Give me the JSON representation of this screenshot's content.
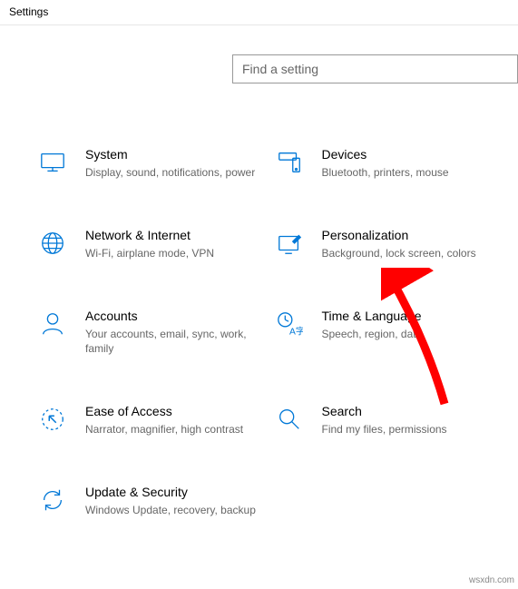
{
  "window": {
    "title": "Settings"
  },
  "search": {
    "placeholder": "Find a setting"
  },
  "tiles": {
    "system": {
      "title": "System",
      "desc": "Display, sound, notifications, power"
    },
    "devices": {
      "title": "Devices",
      "desc": "Bluetooth, printers, mouse"
    },
    "network": {
      "title": "Network & Internet",
      "desc": "Wi-Fi, airplane mode, VPN"
    },
    "personalization": {
      "title": "Personalization",
      "desc": "Background, lock screen, colors"
    },
    "accounts": {
      "title": "Accounts",
      "desc": "Your accounts, email, sync, work, family"
    },
    "timelang": {
      "title": "Time & Language",
      "desc": "Speech, region, date"
    },
    "ease": {
      "title": "Ease of Access",
      "desc": "Narrator, magnifier, high contrast"
    },
    "searchtile": {
      "title": "Search",
      "desc": "Find my files, permissions"
    },
    "update": {
      "title": "Update & Security",
      "desc": "Windows Update, recovery, backup"
    }
  },
  "watermark": "wsxdn.com",
  "colors": {
    "accent": "#0078d7",
    "arrow": "#ff0000"
  }
}
